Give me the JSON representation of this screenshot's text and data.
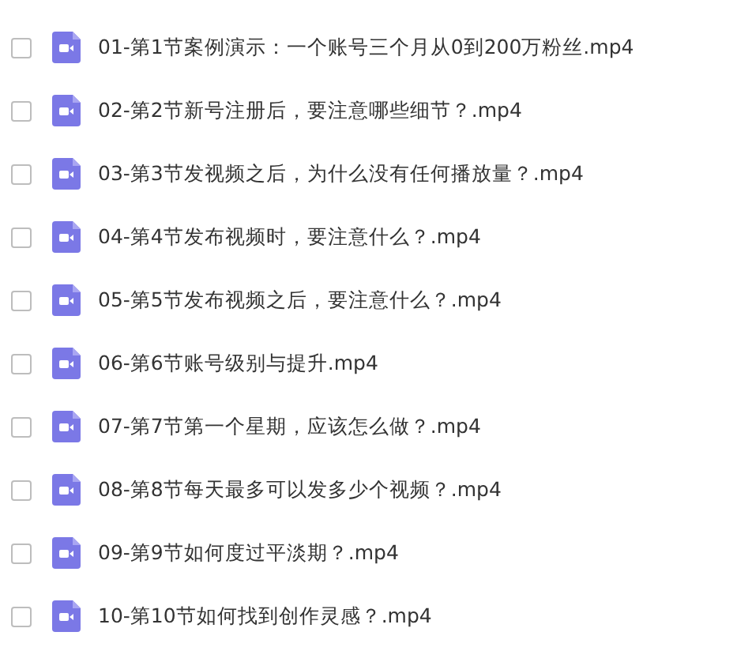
{
  "files": [
    {
      "name": "01-第1节案例演示：一个账号三个月从0到200万粉丝.mp4",
      "checked": false
    },
    {
      "name": "02-第2节新号注册后，要注意哪些细节？.mp4",
      "checked": false
    },
    {
      "name": "03-第3节发视频之后，为什么没有任何播放量？.mp4",
      "checked": false
    },
    {
      "name": "04-第4节发布视频时，要注意什么？.mp4",
      "checked": false
    },
    {
      "name": "05-第5节发布视频之后，要注意什么？.mp4",
      "checked": false
    },
    {
      "name": "06-第6节账号级别与提升.mp4",
      "checked": false
    },
    {
      "name": "07-第7节第一个星期，应该怎么做？.mp4",
      "checked": false
    },
    {
      "name": "08-第8节每天最多可以发多少个视频？.mp4",
      "checked": false
    },
    {
      "name": "09-第9节如何度过平淡期？.mp4",
      "checked": false
    },
    {
      "name": "10-第10节如何找到创作灵感？.mp4",
      "checked": false
    }
  ]
}
